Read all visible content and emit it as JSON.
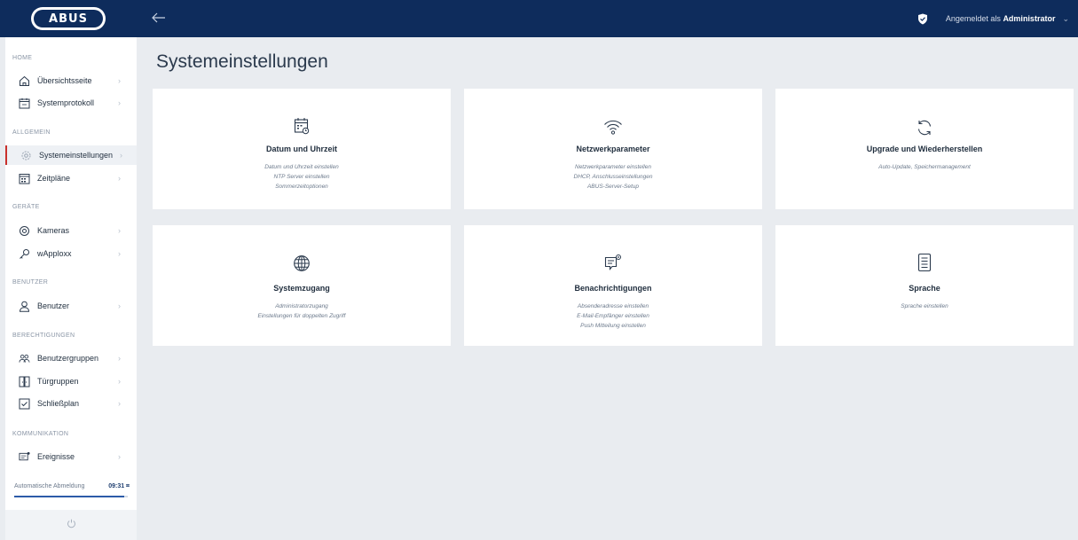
{
  "header": {
    "logo": "ABUS",
    "user_prefix": "Angemeldet als",
    "user_name": "Administrator",
    "user_chevron": "⌄"
  },
  "sidebar": {
    "sections": {
      "home": "HOME",
      "allgemein": "ALLGEMEIN",
      "geraete": "GERÄTE",
      "benutzer": "BENUTZER",
      "berechtigungen": "BERECHTIGUNGEN",
      "kommunikation": "KOMMUNIKATION"
    },
    "items": [
      {
        "label": "Übersichtsseite",
        "chevron": "›"
      },
      {
        "label": "Systemprotokoll",
        "chevron": "›"
      },
      {
        "label": "Systemeinstellungen",
        "chevron": "›"
      },
      {
        "label": "Zeitpläne",
        "chevron": "›"
      },
      {
        "label": "Kameras",
        "chevron": "›"
      },
      {
        "label": "wApploxx",
        "chevron": "›"
      },
      {
        "label": "Benutzer",
        "chevron": "›"
      },
      {
        "label": "Benutzergruppen",
        "chevron": "›"
      },
      {
        "label": "Türgruppen",
        "chevron": "›"
      },
      {
        "label": "Schließplan",
        "chevron": "›"
      },
      {
        "label": "Ereignisse",
        "chevron": "›"
      }
    ],
    "logout": {
      "label": "Automatische Abmeldung",
      "time": "09:31 ⌗",
      "progress": 0.97
    }
  },
  "main": {
    "title": "Systemeinstellungen",
    "cards": [
      {
        "title": "Datum und Uhrzeit",
        "icon": "calendar-clock-icon",
        "lines": [
          "Datum und Uhrzeit einstellen",
          "NTP Server einstellen",
          "Sommerzeitoptionen"
        ]
      },
      {
        "title": "Netzwerkparameter",
        "icon": "wifi-icon",
        "lines": [
          "Netzwerkparameter einstellen",
          "DHCP, Anschlusseinstellungen",
          "ABUS-Server-Setup"
        ]
      },
      {
        "title": "Upgrade und Wiederherstellen",
        "icon": "refresh-icon",
        "lines": [
          "Auto-Update, Speichermanagement"
        ]
      },
      {
        "title": "Systemzugang",
        "icon": "globe-icon",
        "lines": [
          "Administratorzugang",
          "Einstellungen für doppelten Zugriff"
        ]
      },
      {
        "title": "Benachrichtigungen",
        "icon": "notification-message-icon",
        "lines": [
          "Absenderadresse einstellen",
          "E-Mail-Empfänger einstellen",
          "Push Mitteilung einstellen"
        ]
      },
      {
        "title": "Sprache",
        "icon": "document-icon",
        "lines": [
          "Sprache einstellen"
        ]
      }
    ]
  },
  "colors": {
    "topbar": "#0e2c5c",
    "background": "#e9ecf0",
    "active_marker": "#c9302c",
    "accent": "#2c5ba8"
  }
}
